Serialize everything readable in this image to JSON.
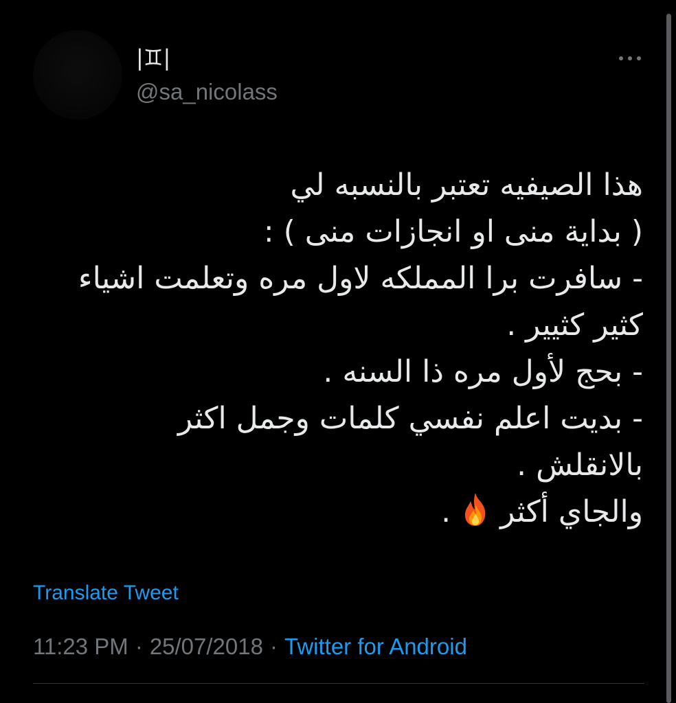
{
  "user": {
    "display_name": "|♊|",
    "handle": "@sa_nicolass"
  },
  "tweet": {
    "lines": [
      "هذا الصيفيه تعتبر بالنسبه لي",
      "( بداية منى او انجازات منى ) :",
      "- سافرت برا المملكه لاول مره وتعلمت اشياء",
      "كثير كثيير .",
      "- بحج لأول مره ذا السنه .",
      "-  بديت اعلم نفسي كلمات وجمل اكثر",
      "بالانقلش .",
      "والجاي أكثر",
      "."
    ],
    "emoji": "fire-icon"
  },
  "translate_label": "Translate Tweet",
  "meta": {
    "time": "11:23 PM",
    "separator": "·",
    "date": "25/07/2018",
    "source": "Twitter for Android"
  },
  "colors": {
    "background": "#000000",
    "text": "#e7e9ea",
    "muted": "#71767b",
    "link": "#1d9bf0",
    "divider": "#2f3336"
  }
}
